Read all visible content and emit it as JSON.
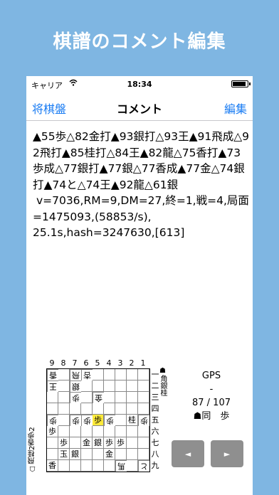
{
  "promo": {
    "title": "棋譜のコメント編集"
  },
  "status_bar": {
    "carrier": "キャリア",
    "wifi_icon": "wifi-icon",
    "time": "18:34",
    "battery_level": 0.9
  },
  "nav": {
    "back_label": "将棋盤",
    "title": "コメント",
    "edit_label": "編集"
  },
  "comment": {
    "text": "▲55歩△82金打▲93銀打△93王▲91飛成△92飛打▲85桂打△84王▲82龍△75香打▲73歩成△77銀打▲77銀△77香成▲77金△74銀打▲74と△74王▲92龍△61銀\n v=7036,RM=9,DM=27,終=1,戦=4,局面=1475093,(58853/s),\n25.1s,hash=3247630,[613]"
  },
  "board": {
    "files": [
      "9",
      "8",
      "7",
      "6",
      "5",
      "4",
      "3",
      "2",
      "1"
    ],
    "ranks": [
      "一",
      "二",
      "三",
      "四",
      "五",
      "六",
      "七",
      "八",
      "九"
    ],
    "cells": [
      [
        {
          "p": "香",
          "w": true
        },
        {
          "p": "",
          "w": false
        },
        {
          "p": "飛",
          "w": true
        },
        {
          "p": "杏",
          "w": true
        },
        {
          "p": "",
          "w": false
        },
        {
          "p": "",
          "w": false
        },
        {
          "p": "",
          "w": false
        },
        {
          "p": "",
          "w": false
        },
        {
          "p": "",
          "w": false
        }
      ],
      [
        {
          "p": "王",
          "w": true
        },
        {
          "p": "",
          "w": false
        },
        {
          "p": "銀",
          "w": true
        },
        {
          "p": "",
          "w": false
        },
        {
          "p": "",
          "w": false
        },
        {
          "p": "",
          "w": false
        },
        {
          "p": "",
          "w": false
        },
        {
          "p": "",
          "w": false
        },
        {
          "p": "",
          "w": false
        }
      ],
      [
        {
          "p": "",
          "w": false
        },
        {
          "p": "",
          "w": false
        },
        {
          "p": "歩",
          "w": true
        },
        {
          "p": "",
          "w": false
        },
        {
          "p": "金",
          "w": true
        },
        {
          "p": "",
          "w": false
        },
        {
          "p": "",
          "w": false
        },
        {
          "p": "",
          "w": false
        },
        {
          "p": "",
          "w": false
        }
      ],
      [
        {
          "p": "",
          "w": false
        },
        {
          "p": "",
          "w": false
        },
        {
          "p": "",
          "w": false
        },
        {
          "p": "",
          "w": false
        },
        {
          "p": "",
          "w": false
        },
        {
          "p": "",
          "w": false
        },
        {
          "p": "",
          "w": false
        },
        {
          "p": "",
          "w": false
        },
        {
          "p": "",
          "w": false
        }
      ],
      [
        {
          "p": "歩",
          "w": true
        },
        {
          "p": "",
          "w": false
        },
        {
          "p": "歩",
          "w": true
        },
        {
          "p": "歩",
          "w": true
        },
        {
          "p": "歩",
          "w": false,
          "hl": true
        },
        {
          "p": "歩",
          "w": true
        },
        {
          "p": "",
          "w": false
        },
        {
          "p": "桂",
          "w": false
        },
        {
          "p": "歩",
          "w": true
        }
      ],
      [
        {
          "p": "歩",
          "w": false
        },
        {
          "p": "",
          "w": false
        },
        {
          "p": "",
          "w": false
        },
        {
          "p": "",
          "w": false
        },
        {
          "p": "",
          "w": false
        },
        {
          "p": "",
          "w": false
        },
        {
          "p": "",
          "w": false
        },
        {
          "p": "",
          "w": false
        },
        {
          "p": "",
          "w": false
        }
      ],
      [
        {
          "p": "",
          "w": false
        },
        {
          "p": "歩",
          "w": false
        },
        {
          "p": "",
          "w": false
        },
        {
          "p": "金",
          "w": false
        },
        {
          "p": "銀",
          "w": false
        },
        {
          "p": "歩",
          "w": false
        },
        {
          "p": "歩",
          "w": false
        },
        {
          "p": "",
          "w": false
        },
        {
          "p": "",
          "w": false
        }
      ],
      [
        {
          "p": "",
          "w": false
        },
        {
          "p": "玉",
          "w": false
        },
        {
          "p": "銀",
          "w": false
        },
        {
          "p": "",
          "w": false
        },
        {
          "p": "",
          "w": false
        },
        {
          "p": "金",
          "w": false
        },
        {
          "p": "",
          "w": false
        },
        {
          "p": "",
          "w": false
        },
        {
          "p": "",
          "w": false
        }
      ],
      [
        {
          "p": "香",
          "w": false
        },
        {
          "p": "",
          "w": false
        },
        {
          "p": "",
          "w": false
        },
        {
          "p": "",
          "w": false
        },
        {
          "p": "",
          "w": false
        },
        {
          "p": "",
          "w": false
        },
        {
          "p": "馬",
          "w": true
        },
        {
          "p": "",
          "w": false
        },
        {
          "p": "と",
          "w": true
        }
      ]
    ]
  },
  "captured": {
    "black": "☗角銀桂",
    "white": "☖飛桂2香歩2"
  },
  "info": {
    "engine": "GPS",
    "dash": "-",
    "move_count": "87 / 107",
    "last_move": "☗同　歩"
  },
  "controls": {
    "prev_label": "◄",
    "next_label": "►"
  }
}
